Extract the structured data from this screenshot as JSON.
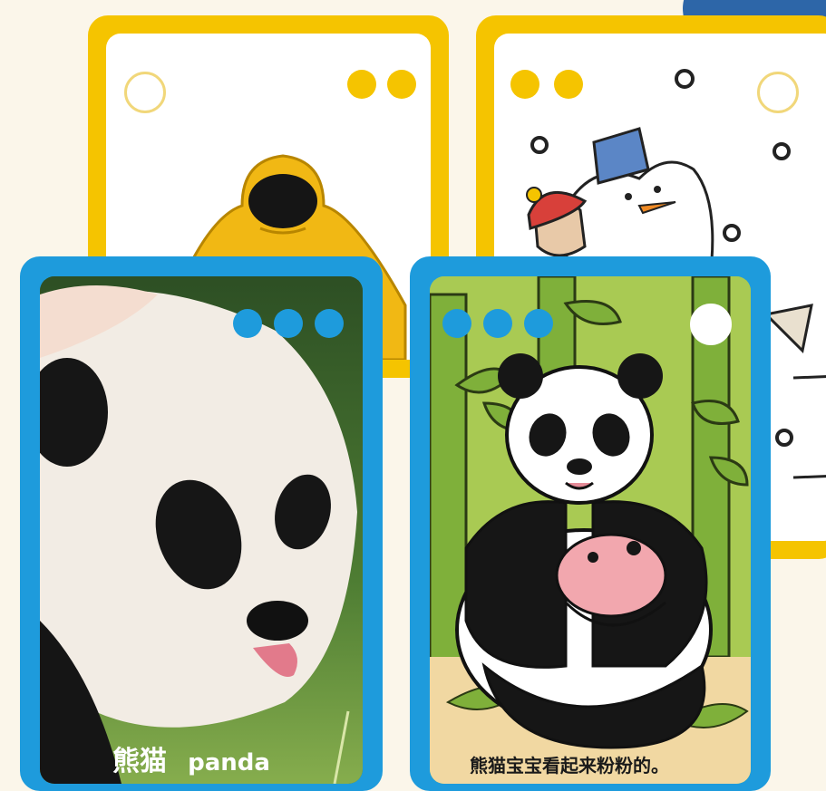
{
  "cards": [
    {
      "id": "yellow-raincoat",
      "dots": 2
    },
    {
      "id": "yellow-snowman",
      "dots": 2
    },
    {
      "id": "blue-panda-photo",
      "dots": 3,
      "caption_cn": "熊猫",
      "caption_en": "panda"
    },
    {
      "id": "blue-panda-illustration",
      "dots": 3,
      "caption": "熊猫宝宝看起来粉粉的。"
    }
  ],
  "colors": {
    "yellow_frame": "#f5c400",
    "blue_frame": "#1e9bdc",
    "dot": "#1e9bdc"
  }
}
